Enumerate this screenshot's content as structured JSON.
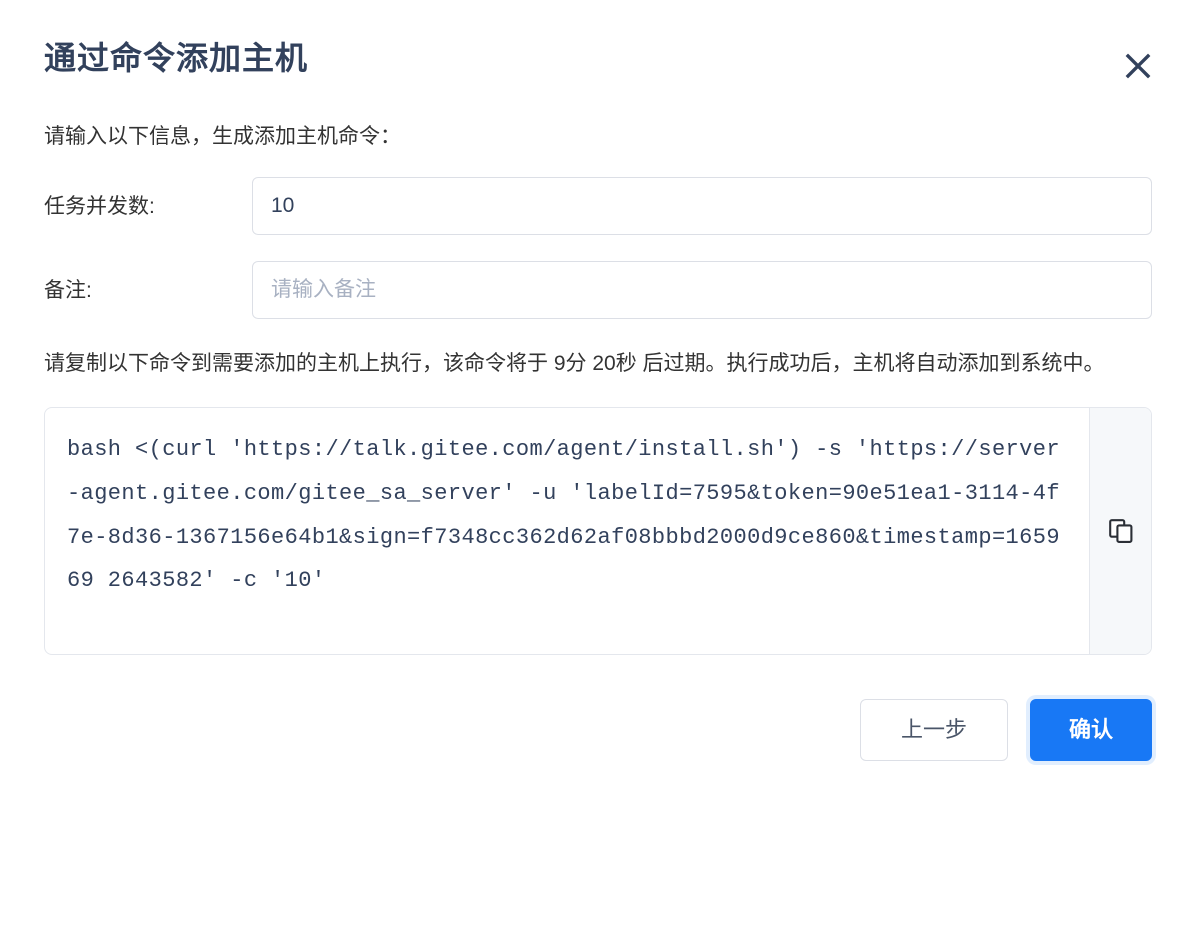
{
  "dialog": {
    "title": "通过命令添加主机",
    "close_icon": "close-icon",
    "intro": "请输入以下信息，生成添加主机命令："
  },
  "form": {
    "concurrency": {
      "label": "任务并发数:",
      "value": "10",
      "placeholder": ""
    },
    "remark": {
      "label": "备注:",
      "value": "",
      "placeholder": "请输入备注"
    }
  },
  "description": "请复制以下命令到需要添加的主机上执行，该命令将于 9分 20秒 后过期。执行成功后，主机将自动添加到系统中。",
  "expiry": {
    "minutes": "9分",
    "seconds": "20秒"
  },
  "command": {
    "text": "bash <(curl 'https://talk.gitee.com/agent/install.sh') -s 'https://server-agent.gitee.com/gitee_sa_server' -u 'labelId=7595&token=90e51ea1-3114-4f7e-8d36-1367156e64b1&sign=f7348cc362d62af08bbbd2000d9ce860&timestamp=165969 2643582' -c '10'",
    "copy_icon": "copy-icon",
    "params": {
      "labelId": "7595",
      "token": "90e51ea1-3114-4f7e-8d36-1367156e64b1",
      "sign": "f7348cc362d62af08bbbd2000d9ce860",
      "timestamp": "1659692643582",
      "concurrency": "10"
    }
  },
  "footer": {
    "back_label": "上一步",
    "confirm_label": "确认"
  },
  "colors": {
    "title": "#32415c",
    "body_text": "#333333",
    "primary": "#1878f5",
    "input_border": "#dcdfe6",
    "placeholder": "#a8b1c2",
    "code_text": "#32415c",
    "copy_bg": "#f6f8fa"
  }
}
